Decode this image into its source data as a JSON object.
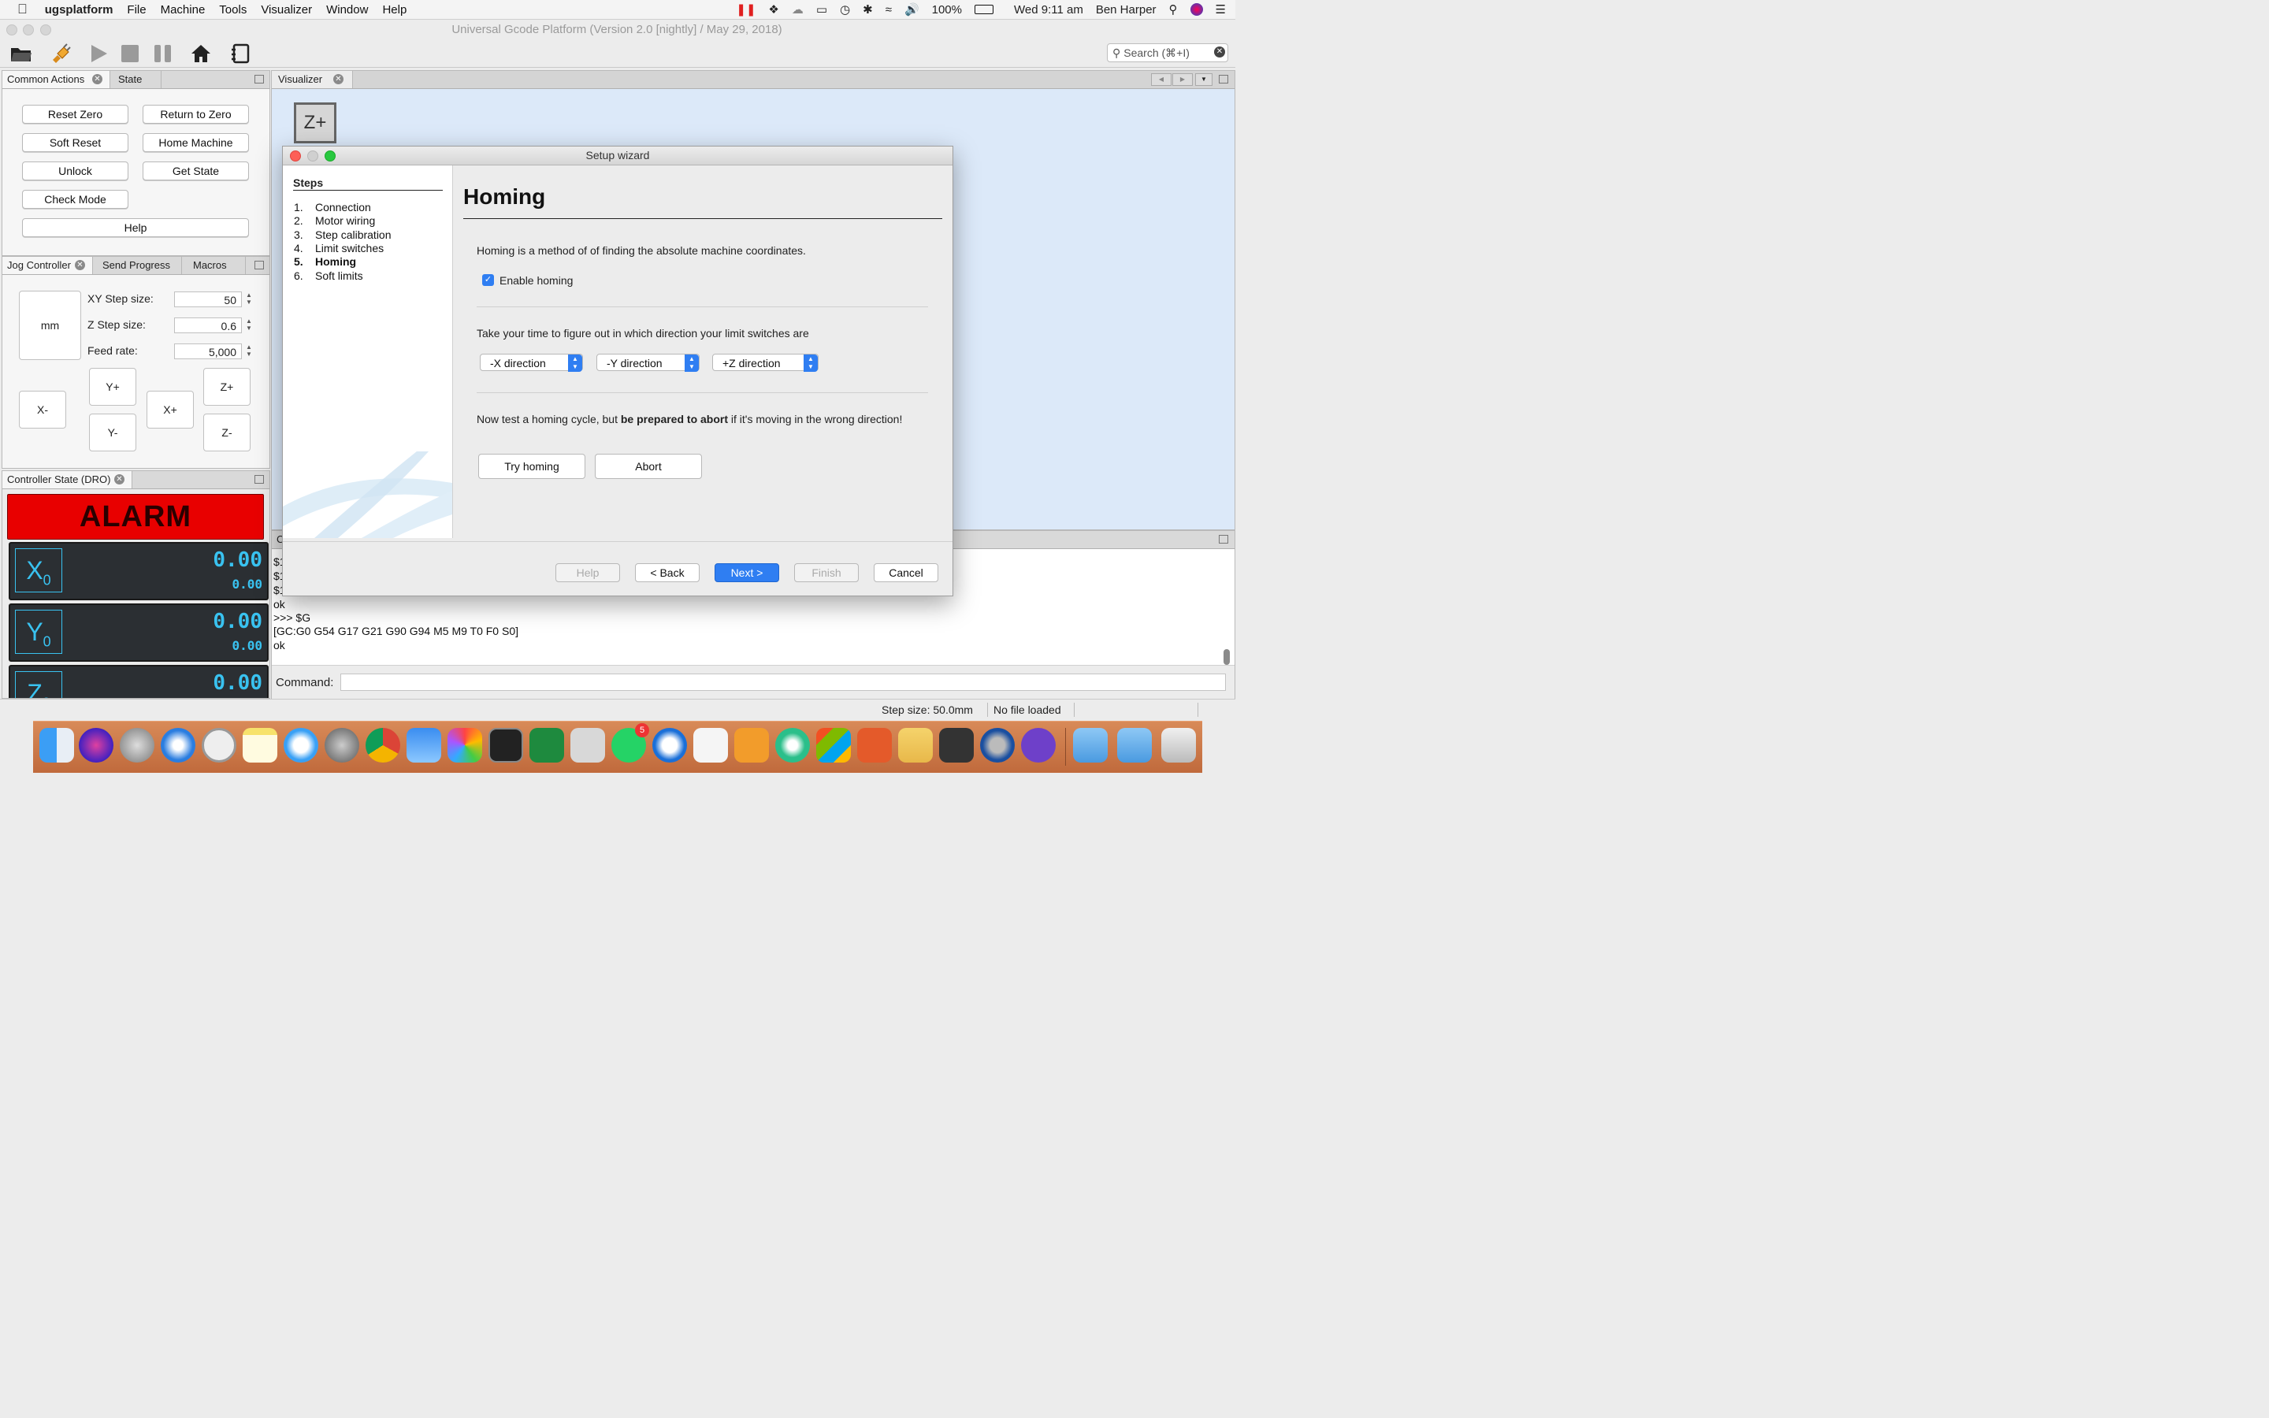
{
  "menubar": {
    "app_name": "ugsplatform",
    "items": [
      "File",
      "Machine",
      "Tools",
      "Visualizer",
      "Window",
      "Help"
    ],
    "battery": "100%",
    "clock": "Wed 9:11 am",
    "user": "Ben Harper"
  },
  "window": {
    "title": "Universal Gcode Platform (Version 2.0 [nightly]  / May 29, 2018)"
  },
  "toolbar": {
    "search_placeholder": "Search (⌘+I)"
  },
  "common_actions": {
    "tabs": [
      "Common Actions",
      "State"
    ],
    "buttons": {
      "reset_zero": "Reset Zero",
      "return_to_zero": "Return to Zero",
      "soft_reset": "Soft Reset",
      "home_machine": "Home Machine",
      "unlock": "Unlock",
      "get_state": "Get State",
      "check_mode": "Check Mode",
      "help": "Help"
    }
  },
  "jog": {
    "tabs": [
      "Jog Controller",
      "Send Progress",
      "Macros"
    ],
    "units": "mm",
    "xy_label": "XY Step size:",
    "xy_value": "50",
    "z_label": "Z Step size:",
    "z_value": "0.6",
    "feed_label": "Feed rate:",
    "feed_value": "5,000",
    "buttons": {
      "x_minus": "X-",
      "x_plus": "X+",
      "y_plus": "Y+",
      "y_minus": "Y-",
      "z_plus": "Z+",
      "z_minus": "Z-"
    }
  },
  "dro": {
    "tab": "Controller State (DRO)",
    "state": "ALARM",
    "state_color": "#e80000",
    "axes": [
      {
        "axis": "X",
        "sub": "0",
        "work": "0.00",
        "machine": "0.00"
      },
      {
        "axis": "Y",
        "sub": "0",
        "work": "0.00",
        "machine": "0.00"
      },
      {
        "axis": "Z",
        "sub": "0",
        "work": "0.00"
      }
    ]
  },
  "visualizer": {
    "tab": "Visualizer",
    "z_plus_label": "Z+"
  },
  "console": {
    "tab_initial": "C",
    "lines": [
      "$1",
      "$1",
      "$1",
      "ok",
      ">>> $G",
      "[GC:G0 G54 G17 G21 G90 G94 M5 M9 T0 F0 S0]",
      "ok"
    ],
    "command_label": "Command:"
  },
  "wizard": {
    "title": "Setup wizard",
    "steps_header": "Steps",
    "steps": [
      {
        "num": "1.",
        "label": "Connection"
      },
      {
        "num": "2.",
        "label": "Motor wiring"
      },
      {
        "num": "3.",
        "label": "Step calibration"
      },
      {
        "num": "4.",
        "label": "Limit switches"
      },
      {
        "num": "5.",
        "label": "Homing"
      },
      {
        "num": "6.",
        "label": "Soft limits"
      }
    ],
    "active_step": 5,
    "heading": "Homing",
    "intro": "Homing is a method of of finding the absolute machine coordinates.",
    "enable_homing_label": "Enable homing",
    "enable_homing_checked": true,
    "direction_text": "Take your time to figure out in which direction your limit switches are",
    "directions": [
      "-X direction",
      "-Y direction",
      "+Z direction"
    ],
    "test_text_pre": "Now test a homing cycle, but ",
    "test_text_bold": "be prepared to abort",
    "test_text_post": " if it's moving in the wrong direction!",
    "try_homing": "Try homing",
    "abort": "Abort",
    "footer": {
      "help": "Help",
      "back": "< Back",
      "next": "Next >",
      "finish": "Finish",
      "cancel": "Cancel"
    },
    "accent": "#2f7ef2"
  },
  "statusbar": {
    "step_size": "Step size: 50.0mm",
    "file": "No file loaded"
  },
  "dock": {
    "whatsapp_badge": "5"
  }
}
